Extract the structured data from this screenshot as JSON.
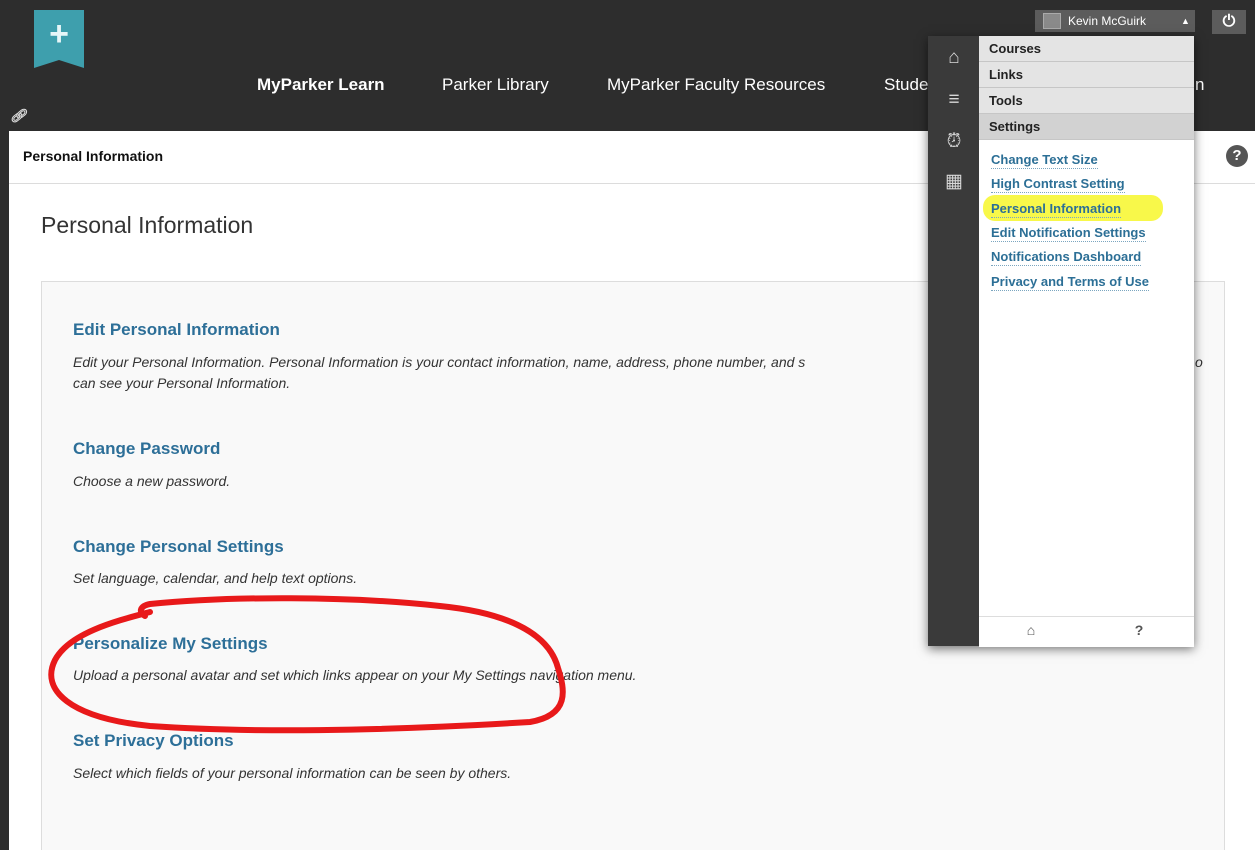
{
  "header": {
    "nav": [
      {
        "label": "MyParker Learn"
      },
      {
        "label": "Parker Library"
      },
      {
        "label": "MyParker Faculty Resources"
      },
      {
        "label": "Stude"
      },
      {
        "label": "n"
      }
    ],
    "user_name": "Kevin McGuirk",
    "icons": {
      "add": "plus-icon",
      "pin": "link-icon",
      "caret": "caret-up-icon",
      "logout": "power-icon"
    }
  },
  "page_bar": {
    "breadcrumb": "Personal Information"
  },
  "page": {
    "title": "Personal Information",
    "options": [
      {
        "title": "Edit Personal Information",
        "description": "Edit your Personal Information. Personal Information is your contact information, name, address, phone number, and s",
        "description_tail": "o",
        "description_line2": "can see your Personal Information."
      },
      {
        "title": "Change Password",
        "description": "Choose a new password."
      },
      {
        "title": "Change Personal Settings",
        "description": "Set language, calendar, and help text options."
      },
      {
        "title": "Personalize My Settings",
        "description": "Upload a personal avatar and set which links appear on your My Settings navigation menu."
      },
      {
        "title": "Set Privacy Options",
        "description": "Select which fields of your personal information can be seen by others."
      }
    ]
  },
  "menu": {
    "sections": [
      "Courses",
      "Links",
      "Tools",
      "Settings"
    ],
    "active_section": "Settings",
    "links": [
      "Change Text Size",
      "High Contrast Setting",
      "Personal Information",
      "Edit Notification Settings",
      "Notifications Dashboard",
      "Privacy and Terms of Use"
    ],
    "highlighted_link": "Personal Information",
    "rail_icons": [
      "blackboard-home-icon",
      "stream-icon",
      "alarm-clock-icon",
      "calendar-icon"
    ],
    "footer_icons": [
      "institution-icon",
      "help-icon"
    ],
    "footer_help": "?"
  },
  "colors": {
    "link": "#2d6f98",
    "topbar": "#2d2d2d",
    "accent": "#3e9fad",
    "highlight": "#f8f84a",
    "annotation": "#e8191a"
  }
}
